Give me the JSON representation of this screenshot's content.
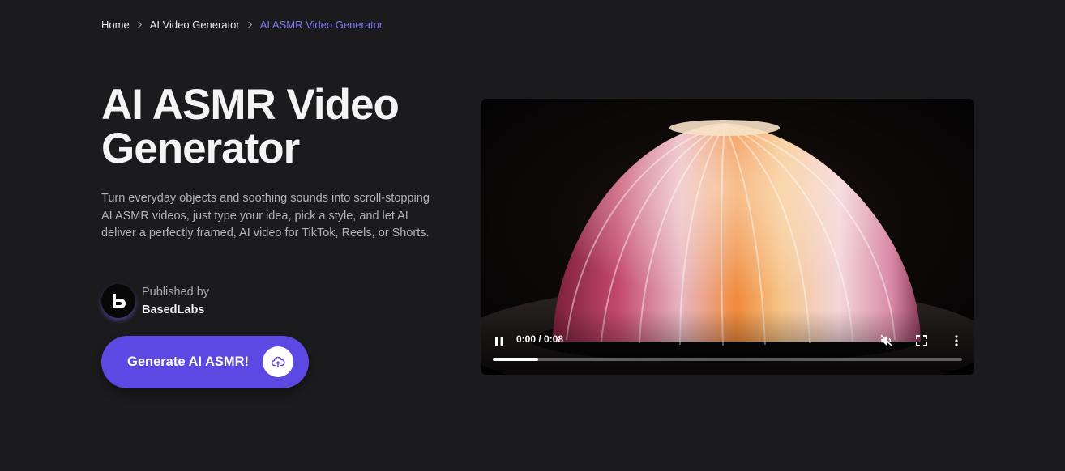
{
  "breadcrumb": {
    "items": [
      "Home",
      "AI Video Generator"
    ],
    "current": "AI ASMR Video Generator"
  },
  "hero": {
    "title": "AI ASMR Video Generator",
    "description": "Turn everyday objects and soothing sounds into scroll-stopping AI ASMR videos, just type your idea, pick a style, and let AI deliver a perfectly framed, AI video for TikTok, Reels, or Shorts.",
    "publisher_label": "Published by",
    "publisher_name": "BasedLabs",
    "cta_label": "Generate AI ASMR!"
  },
  "video": {
    "time": "0:00 / 0:08",
    "progress": 0.097,
    "state": "playing",
    "muted": true
  },
  "colors": {
    "background": "#1b1b1d",
    "accent": "#5c48e2",
    "breadcrumb_current": "#7d78f0"
  },
  "icons": [
    "chevron-right-icon",
    "basedlabs-logo",
    "upload-cloud-icon",
    "pause-icon",
    "volume-muted-icon",
    "fullscreen-icon",
    "more-vert-icon"
  ]
}
